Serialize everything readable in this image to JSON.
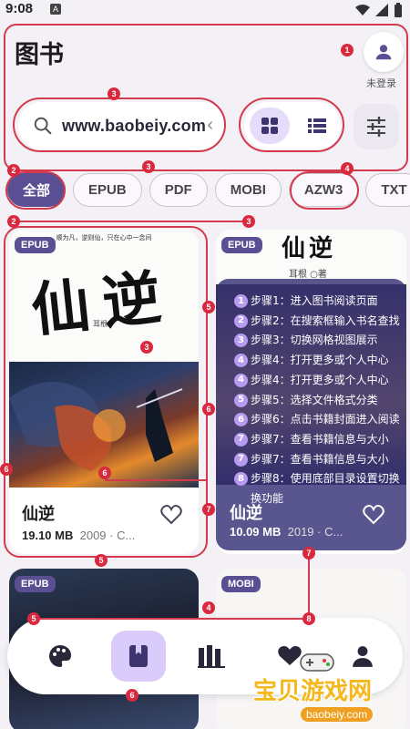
{
  "status": {
    "time": "9:08",
    "app_badge": "A"
  },
  "header": {
    "title": "图书",
    "login_label": "未登录"
  },
  "search": {
    "query": "www.baobeiy.com"
  },
  "chips": [
    {
      "label": "全部",
      "active": true
    },
    {
      "label": "EPUB",
      "active": false
    },
    {
      "label": "PDF",
      "active": false
    },
    {
      "label": "MOBI",
      "active": false
    },
    {
      "label": "AZW3",
      "active": false
    },
    {
      "label": "TXT",
      "active": false
    }
  ],
  "books": [
    {
      "format": "EPUB",
      "title": "仙逆",
      "size": "19.10 MB",
      "meta": "2009 · C...",
      "cover_title": "仙逆",
      "cover_author": "耳根",
      "cover_tagline": "顺为凡，逆则仙，只在心中一念间"
    },
    {
      "format": "EPUB",
      "title": "仙逆",
      "size": "10.09 MB",
      "meta": "2019 · C...",
      "cover_title": "仙逆",
      "cover_author": "耳根 ○著"
    },
    {
      "format": "EPUB"
    },
    {
      "format": "MOBI"
    }
  ],
  "steps": [
    {
      "n": "1",
      "text": "步骤1：进入图书阅读页面"
    },
    {
      "n": "2",
      "text": "步骤2：在搜索框输入书名查找"
    },
    {
      "n": "3",
      "text": "步骤3：切换网格视图展示"
    },
    {
      "n": "4",
      "text": "步骤4：打开更多或个人中心"
    },
    {
      "n": "4",
      "text": "步骤4：打开更多或个人中心"
    },
    {
      "n": "5",
      "text": "步骤5：选择文件格式分类"
    },
    {
      "n": "6",
      "text": "步骤6：点击书籍封面进入阅读"
    },
    {
      "n": "7",
      "text": "步骤7：查看书籍信息与大小"
    },
    {
      "n": "7",
      "text": "步骤7：查看书籍信息与大小"
    },
    {
      "n": "8",
      "text": "步骤8：使用底部目录设置切换换功能"
    }
  ],
  "markers": [
    "1",
    "2",
    "2",
    "3",
    "3",
    "3",
    "3",
    "4",
    "4",
    "5",
    "5",
    "5",
    "6",
    "6",
    "6",
    "6",
    "7",
    "7",
    "8"
  ],
  "watermark": {
    "zh": "宝贝游戏网",
    "en": "baobeiy.com"
  },
  "colors": {
    "accent": "#5b4f93",
    "annotation": "#d8293f",
    "chip_active": "#5b4f93",
    "nav_active": "#d9ccfb"
  },
  "icons": {
    "search": "search-icon",
    "grid": "grid-view-icon",
    "list": "list-view-icon",
    "filter": "sliders-icon",
    "person": "person-icon",
    "heart": "heart-outline-icon",
    "palette": "palette-icon",
    "book": "book-icon",
    "shelf": "bookshelf-icon"
  }
}
